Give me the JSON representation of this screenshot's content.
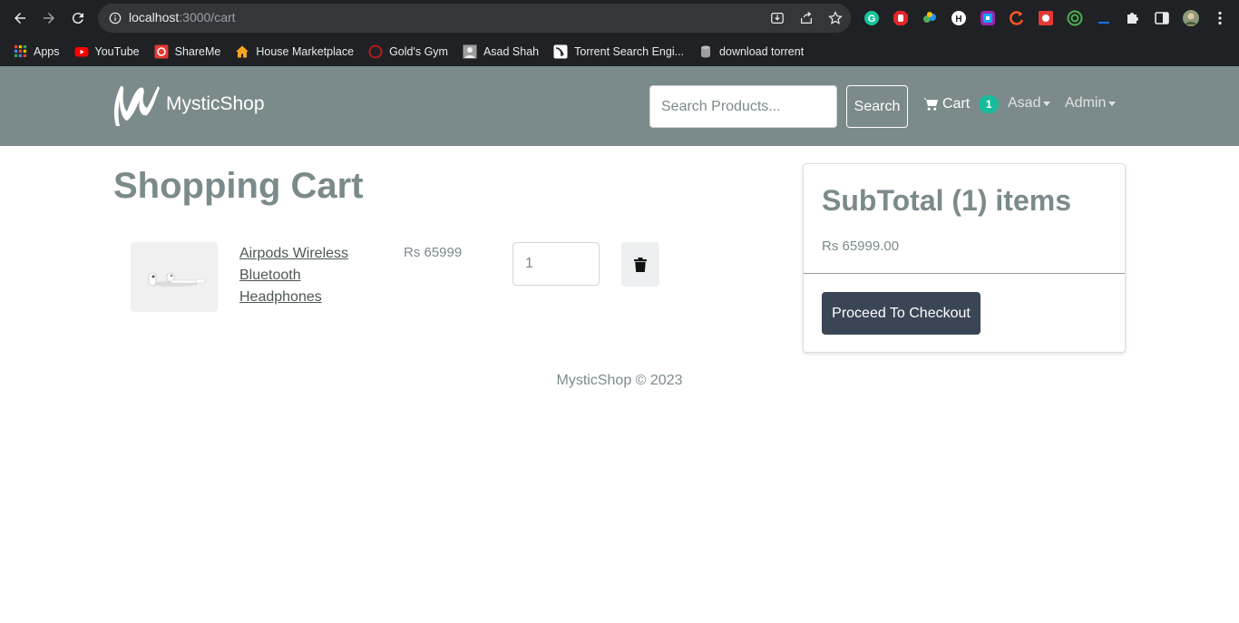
{
  "browser": {
    "url_host": "localhost",
    "url_path": ":3000/cart",
    "bookmarks": [
      {
        "label": "Apps",
        "icon": "apps-grid-icon"
      },
      {
        "label": "YouTube",
        "icon": "youtube-icon"
      },
      {
        "label": "ShareMe",
        "icon": "shareme-icon"
      },
      {
        "label": "House Marketplace",
        "icon": "house-icon"
      },
      {
        "label": "Gold's Gym",
        "icon": "golds-gym-icon"
      },
      {
        "label": "Asad Shah",
        "icon": "person-icon"
      },
      {
        "label": "Torrent Search Engi...",
        "icon": "torrent-icon"
      },
      {
        "label": "download torrent",
        "icon": "database-icon"
      }
    ]
  },
  "navbar": {
    "brand": "MysticShop",
    "search_placeholder": "Search Products...",
    "search_button": "Search",
    "cart_label": "Cart",
    "cart_count": "1",
    "user_menu": "Asad",
    "admin_menu": "Admin",
    "bg_color": "#7b8a8b",
    "badge_color": "#18bc9c"
  },
  "cart": {
    "title": "Shopping Cart",
    "items": [
      {
        "name": "Airpods Wireless Bluetooth Headphones",
        "price": "Rs 65999",
        "quantity": "1"
      }
    ]
  },
  "summary": {
    "title": "SubTotal (1) items",
    "total": "Rs 65999.00",
    "checkout_button": "Proceed To Checkout",
    "button_color": "#3a4555"
  },
  "footer": {
    "text": "MysticShop © 2023"
  }
}
